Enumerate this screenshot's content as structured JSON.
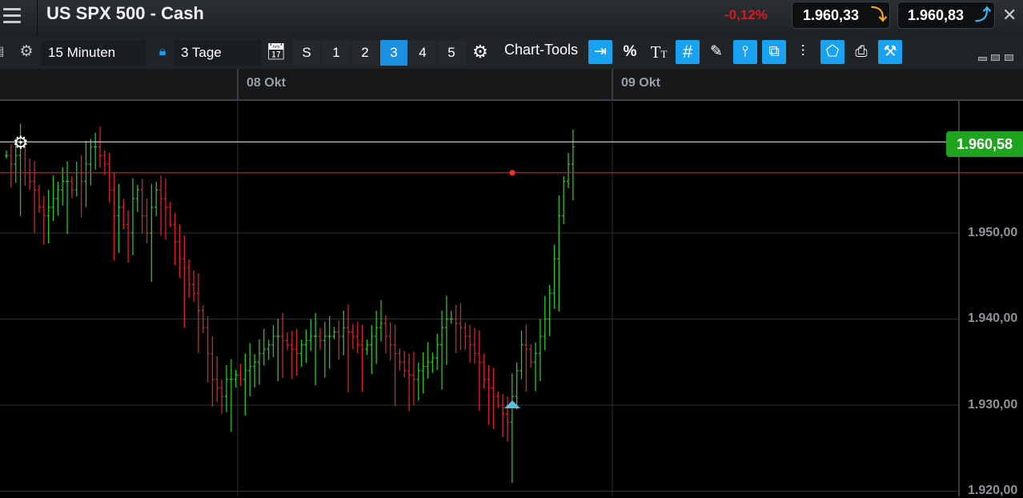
{
  "header": {
    "title": "US SPX 500 - Cash",
    "change": "-0,12%",
    "sell_price": "1.960,33",
    "buy_price": "1.960,83"
  },
  "toolbar": {
    "interval": "15 Minuten",
    "range": "3 Tage",
    "range_buttons": [
      "S",
      "1",
      "2",
      "3",
      "4",
      "5"
    ],
    "range_active": "3",
    "chart_tools_label": "Chart-Tools",
    "tools": [
      "fit-icon",
      "percent-icon",
      "text-tool-icon",
      "grid-icon",
      "draw-icon",
      "bar-type-icon",
      "compare-icon",
      "candle-icon",
      "tag-icon",
      "print-icon",
      "settings-tool-icon"
    ]
  },
  "chart": {
    "x_labels": [
      "08 Okt",
      "09 Okt"
    ],
    "y_labels": [
      "1.950,00",
      "1.940,00",
      "1.930,00",
      "1.920,00"
    ],
    "current_price_tag": "1.960,58",
    "colors": {
      "up": "#23c623",
      "down": "#e12026",
      "current_line": "#c9c9c9",
      "order_line": "#d11a1a",
      "price_tag": "#1fa41f",
      "marker": "#5ec0e0"
    }
  },
  "chart_data": {
    "type": "ohlc",
    "title": "US SPX 500 - Cash",
    "interval": "15 Minuten",
    "period": "3 Tage",
    "x_ticks": [
      "08 Okt",
      "09 Okt"
    ],
    "ylim": [
      1920,
      1964
    ],
    "y_ticks": [
      1920,
      1930,
      1940,
      1950
    ],
    "current_price": 1960.58,
    "horizontal_line": 1957.0,
    "low_marker": 1930.0,
    "close": [
      1959,
      1958,
      1959,
      1960,
      1957,
      1956,
      1955,
      1953,
      1952,
      1953,
      1954,
      1955,
      1956,
      1956,
      1955,
      1957,
      1956,
      1958,
      1960,
      1960,
      1959,
      1958,
      1955,
      1952,
      1953,
      1951,
      1950,
      1954,
      1955,
      1952,
      1950,
      1953,
      1955,
      1954,
      1953,
      1951,
      1949,
      1947,
      1946,
      1944,
      1943,
      1941,
      1939,
      1936,
      1933,
      1932,
      1931,
      1933,
      1933,
      1933.5,
      1933,
      1934,
      1934.5,
      1935,
      1936,
      1936.5,
      1937,
      1938,
      1938,
      1937.5,
      1937,
      1936.5,
      1936,
      1937,
      1937.5,
      1938,
      1938,
      1937.5,
      1938,
      1938,
      1938.5,
      1938,
      1939,
      1938.5,
      1938,
      1937,
      1936.5,
      1937,
      1938,
      1939,
      1939.5,
      1938,
      1937,
      1936,
      1935,
      1934,
      1933.5,
      1933,
      1934,
      1934.5,
      1935,
      1935.5,
      1937,
      1939,
      1940,
      1940,
      1939.5,
      1939,
      1938,
      1937,
      1936,
      1935,
      1933,
      1932,
      1931,
      1930,
      1929,
      1928,
      1931,
      1934,
      1937,
      1936.5,
      1935,
      1936,
      1938,
      1940,
      1943,
      1947,
      1952,
      1956,
      1958,
      1960
    ]
  }
}
